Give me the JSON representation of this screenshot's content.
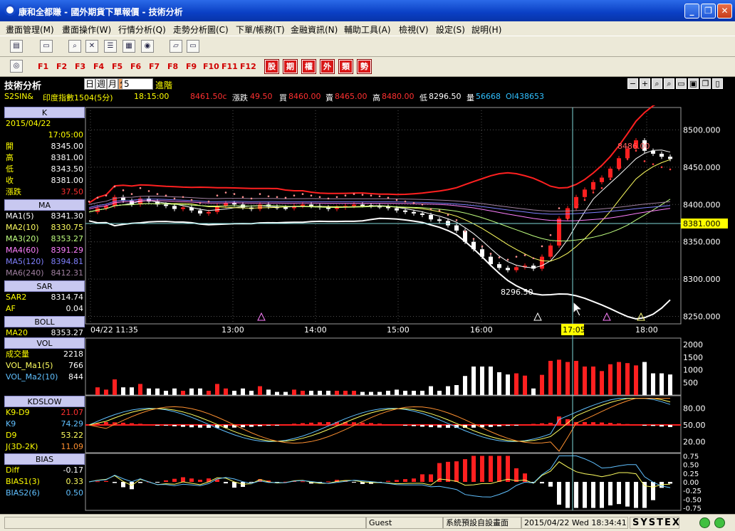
{
  "window": {
    "title": "康和全都賺 - 國外期貨下單報價 - 技術分析"
  },
  "menu": [
    {
      "label": "畫面管理(M)"
    },
    {
      "label": "畫面操作(W)"
    },
    {
      "label": "行情分析(Q)"
    },
    {
      "label": "走勢分析圖(C)"
    },
    {
      "label": "下單/帳務(T)"
    },
    {
      "label": "金融資訊(N)"
    },
    {
      "label": "輔助工具(A)"
    },
    {
      "label": "檢視(V)"
    },
    {
      "label": "設定(S)"
    },
    {
      "label": "說明(H)"
    }
  ],
  "toolbar1_icons": [
    "window-icon",
    "monitor-icon",
    "search-icon",
    "close-box-icon",
    "layout-icon",
    "grid-icon",
    "globe-icon",
    "chat-icon",
    "card-icon"
  ],
  "fkeys": [
    "F1",
    "F2",
    "F3",
    "F4",
    "F5",
    "F6",
    "F7",
    "F8",
    "F9",
    "F10",
    "F11",
    "F12"
  ],
  "quick_buttons": [
    "股",
    "期",
    "權",
    "外",
    "類",
    "勢"
  ],
  "chart_header": {
    "label": "技術分析",
    "periods": [
      "日",
      "週",
      "月",
      "分"
    ],
    "selected_period": "分",
    "interval": "5",
    "advanced": "進階",
    "controls": [
      "−",
      "+",
      "🔍",
      "🔍",
      "▭",
      "▭",
      "▭",
      "▯"
    ]
  },
  "quote": {
    "symbol": "S2SIN&",
    "name": "印度指數1504(5分)",
    "time": "18:15:00",
    "price": "8461.50c",
    "change_label": "漲跌",
    "change": "49.50",
    "bid_label": "買",
    "bid": "8460.00",
    "ask_label": "賣",
    "ask": "8465.00",
    "high_label": "高",
    "high": "8480.00",
    "low_label": "低",
    "low": "8296.50",
    "vol_label": "量",
    "vol": "56668",
    "oi_label": "OI",
    "oi": "438653"
  },
  "left": {
    "k": {
      "title": "K",
      "date": "2015/04/22",
      "time": "17:05:00",
      "rows": [
        {
          "k": "開",
          "v": "8345.00"
        },
        {
          "k": "高",
          "v": "8381.00"
        },
        {
          "k": "低",
          "v": "8343.50"
        },
        {
          "k": "收",
          "v": "8381.00"
        },
        {
          "k": "漲跌",
          "v": "37.50"
        }
      ]
    },
    "ma": {
      "title": "MA",
      "rows": [
        {
          "k": "MA1(5)",
          "v": "8341.30"
        },
        {
          "k": "MA2(10)",
          "v": "8330.75"
        },
        {
          "k": "MA3(20)",
          "v": "8353.27"
        },
        {
          "k": "MA4(60)",
          "v": "8391.29"
        },
        {
          "k": "MA5(120)",
          "v": "8394.81"
        },
        {
          "k": "MA6(240)",
          "v": "8412.31"
        }
      ]
    },
    "sar": {
      "title": "SAR",
      "rows": [
        {
          "k": "SAR2",
          "v": "8314.74"
        },
        {
          "k": "AF",
          "v": "0.04"
        }
      ]
    },
    "boll": {
      "title": "BOLL",
      "rows": [
        {
          "k": "MA20",
          "v": "8353.27"
        }
      ]
    },
    "vol": {
      "title": "VOL",
      "rows": [
        {
          "k": "成交量",
          "v": "2218"
        },
        {
          "k": "VOL_Ma1(5)",
          "v": "766"
        },
        {
          "k": "VOL_Ma2(10)",
          "v": "844"
        }
      ]
    },
    "kd": {
      "title": "KDSLOW",
      "rows": [
        {
          "k": "K9-D9",
          "v": "21.07"
        },
        {
          "k": "K9",
          "v": "74.29"
        },
        {
          "k": "D9",
          "v": "53.22"
        },
        {
          "k": "J(3D-2K)",
          "v": "11.09"
        }
      ]
    },
    "bias": {
      "title": "BIAS",
      "rows": [
        {
          "k": "Diff",
          "v": "-0.17"
        },
        {
          "k": "BIAS1(3)",
          "v": "0.33"
        },
        {
          "k": "BIAS2(6)",
          "v": "0.50"
        }
      ]
    }
  },
  "chart_data": [
    {
      "type": "candlestick",
      "title": "",
      "y_axis_ticks": [
        "8500.000",
        "8450.000",
        "8400.000",
        "8350.000",
        "8300.000",
        "8250.000"
      ],
      "ylim": [
        8240,
        8530
      ],
      "x_axis_ticks": [
        "04/22 11:35",
        "13:00",
        "14:00",
        "15:00",
        "16:00",
        "17:05",
        "18:00"
      ],
      "cursor_price_label": "8381.000",
      "cursor_time_label": "17:05",
      "annotations": [
        "8486.00",
        "8296.50"
      ],
      "close_series": [
        8390,
        8395,
        8398,
        8410,
        8405,
        8400,
        8408,
        8404,
        8400,
        8398,
        8394,
        8396,
        8392,
        8388,
        8390,
        8398,
        8402,
        8400,
        8396,
        8394,
        8400,
        8397,
        8396,
        8395,
        8398,
        8400,
        8398,
        8396,
        8394,
        8396,
        8398,
        8400,
        8399,
        8398,
        8397,
        8395,
        8392,
        8390,
        8388,
        8386,
        8380,
        8378,
        8372,
        8365,
        8350,
        8340,
        8330,
        8320,
        8315,
        8312,
        8316,
        8318,
        8314,
        8330,
        8345,
        8381,
        8395,
        8410,
        8420,
        8430,
        8436,
        8448,
        8462,
        8475,
        8486,
        8472,
        8468,
        8464,
        8461
      ]
    },
    {
      "type": "bar",
      "title": "",
      "y_axis_ticks": [
        "2000",
        "1500",
        "1000",
        "500"
      ],
      "ylim": [
        0,
        2200
      ]
    },
    {
      "type": "line",
      "title": "",
      "y_axis_ticks": [
        "80.00",
        "50.00",
        "20.00"
      ],
      "ylim": [
        0,
        100
      ]
    },
    {
      "type": "bar",
      "title": "",
      "y_axis_ticks": [
        "0.75",
        "0.50",
        "0.25",
        "0.00",
        "-0.25",
        "-0.50",
        "-0.75"
      ],
      "ylim": [
        -0.8,
        0.8
      ]
    }
  ],
  "status": {
    "user": "Guest",
    "layout": "系統預設自設畫面",
    "datetime": "2015/04/22 Wed 18:34:41",
    "brand": "SYSTEX"
  },
  "colors": {
    "up": "#ff2020",
    "down": "#ffffff",
    "grid": "#606060",
    "accent": "#ffff00"
  }
}
